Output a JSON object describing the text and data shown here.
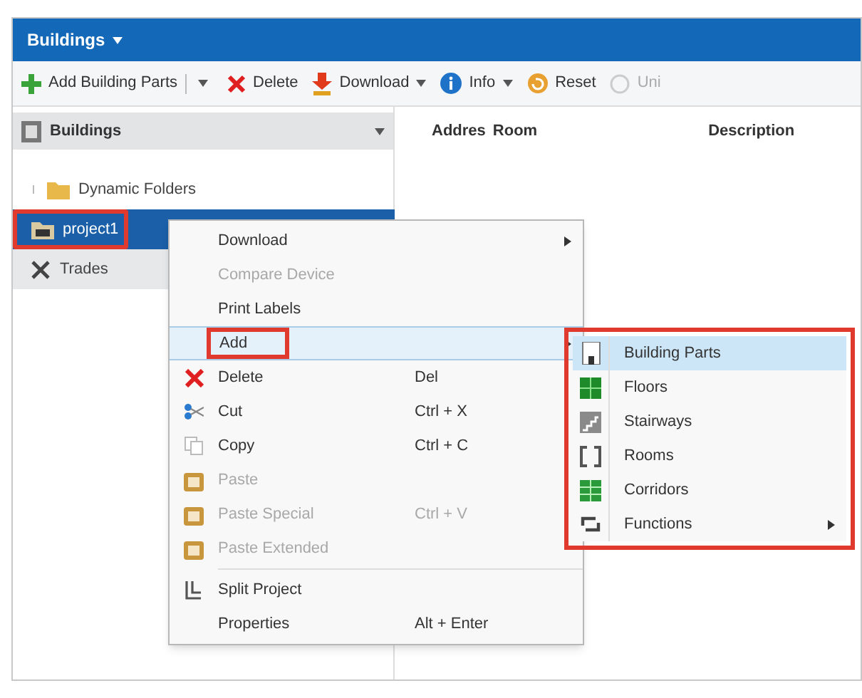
{
  "window": {
    "title": "Buildings"
  },
  "toolbar": [
    {
      "kind": "split",
      "label": "Add Building Parts",
      "disabled": false
    },
    {
      "kind": "button",
      "label": "Delete",
      "dropdown": false,
      "disabled": false
    },
    {
      "kind": "button",
      "label": "Download",
      "dropdown": true,
      "disabled": false
    },
    {
      "kind": "button",
      "label": "Info",
      "dropdown": true,
      "disabled": false
    },
    {
      "kind": "button",
      "label": "Reset",
      "dropdown": false,
      "disabled": false
    },
    {
      "kind": "button",
      "label": "Uni",
      "dropdown": false,
      "disabled": true
    }
  ],
  "sidebar": {
    "header": "Buildings",
    "items": [
      {
        "label": "Dynamic Folders",
        "selected": false,
        "highlighted": false,
        "expandable": true
      },
      {
        "label": "project1",
        "selected": true,
        "highlighted": true,
        "expandable": false
      },
      {
        "label": "Trades",
        "selected": false,
        "highlighted": false,
        "expandable": false
      }
    ]
  },
  "table": {
    "columns": [
      "Addres",
      "Room",
      "Description"
    ]
  },
  "context_menu": [
    {
      "label": "Download",
      "disabled": false,
      "selected": false,
      "highlighted": false,
      "submenu": true
    },
    {
      "label": "Compare Device",
      "disabled": true,
      "selected": false,
      "highlighted": false,
      "submenu": false
    },
    {
      "label": "Print Labels",
      "disabled": false,
      "selected": false,
      "highlighted": false,
      "submenu": false
    },
    {
      "label": "Add",
      "disabled": false,
      "selected": true,
      "highlighted": true,
      "submenu": true
    },
    {
      "label": "Delete",
      "shortcut": "Del",
      "disabled": false,
      "selected": false,
      "highlighted": false,
      "submenu": false
    },
    {
      "label": "Cut",
      "shortcut": "Ctrl + X",
      "disabled": false,
      "selected": false,
      "highlighted": false,
      "submenu": false
    },
    {
      "label": "Copy",
      "shortcut": "Ctrl + C",
      "disabled": false,
      "selected": false,
      "highlighted": false,
      "submenu": false
    },
    {
      "label": "Paste",
      "disabled": true,
      "selected": false,
      "highlighted": false,
      "submenu": false
    },
    {
      "label": "Paste Special",
      "shortcut": "Ctrl + V",
      "disabled": true,
      "selected": false,
      "highlighted": false,
      "submenu": false
    },
    {
      "label": "Paste Extended",
      "disabled": true,
      "selected": false,
      "highlighted": false,
      "submenu": false
    },
    {
      "label": "Split Project",
      "disabled": false,
      "selected": false,
      "highlighted": false,
      "submenu": false
    },
    {
      "label": "Properties",
      "shortcut": "Alt + Enter",
      "disabled": false,
      "selected": false,
      "highlighted": false,
      "submenu": false
    }
  ],
  "submenu": {
    "highlighted": true,
    "items": [
      {
        "label": "Building Parts",
        "selected": true,
        "submenu": false
      },
      {
        "label": "Floors",
        "selected": false,
        "submenu": false
      },
      {
        "label": "Stairways",
        "selected": false,
        "submenu": false
      },
      {
        "label": "Rooms",
        "selected": false,
        "submenu": false
      },
      {
        "label": "Corridors",
        "selected": false,
        "submenu": false
      },
      {
        "label": "Functions",
        "selected": false,
        "submenu": true
      }
    ]
  }
}
